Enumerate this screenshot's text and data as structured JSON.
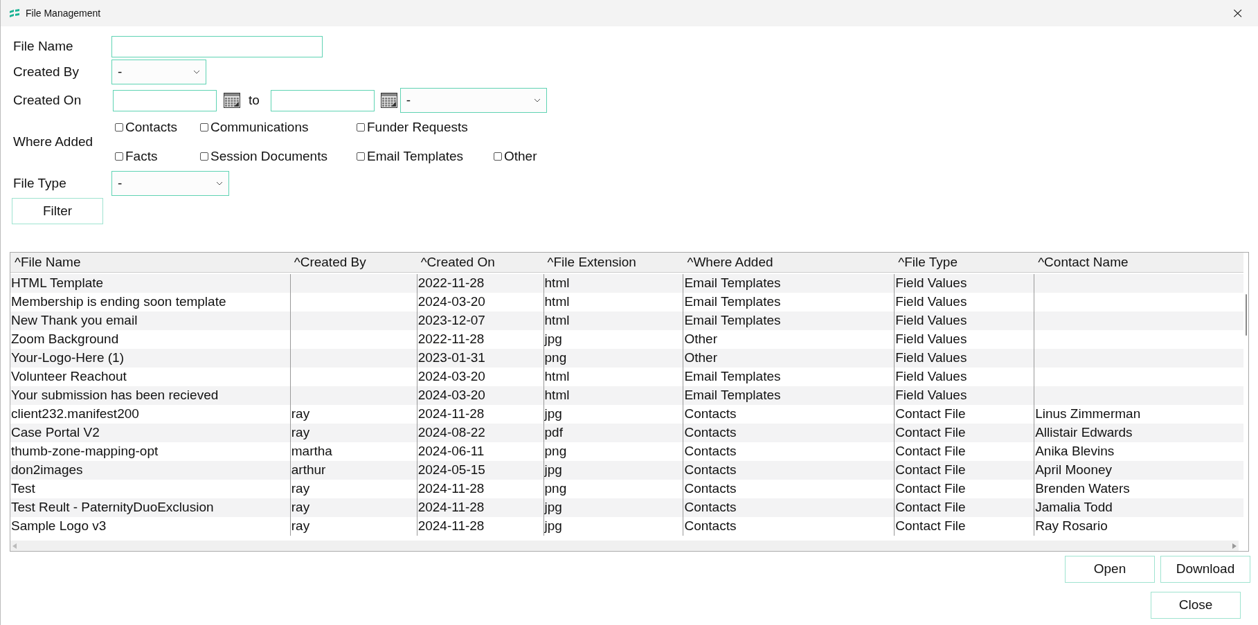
{
  "window": {
    "title": "File Management",
    "close": "×"
  },
  "filters": {
    "file_name": {
      "label": "File Name"
    },
    "created_by": {
      "label": "Created By",
      "value": "-"
    },
    "created_on": {
      "label": "Created On",
      "to_label": "to",
      "range": "-"
    },
    "where_added": {
      "label": "Where Added",
      "rows": [
        [
          {
            "label": "Contacts",
            "checked": false
          },
          {
            "label": "Communications",
            "checked": false
          },
          {
            "label": "Funder Requests",
            "checked": false
          }
        ],
        [
          {
            "label": "Facts",
            "checked": false
          },
          {
            "label": "Session Documents",
            "checked": false
          },
          {
            "label": "Email Templates",
            "checked": false
          },
          {
            "label": "Other",
            "checked": false
          }
        ]
      ]
    },
    "file_type": {
      "label": "File Type",
      "value": "-"
    },
    "filter_button": "Filter"
  },
  "table": {
    "columns": [
      "^File Name",
      "^Created By",
      "^Created On",
      "^File Extension",
      "^Where Added",
      "^File Type",
      "^Contact Name"
    ],
    "rows": [
      [
        "HTML Template",
        "",
        "2022-11-28",
        "html",
        "Email Templates",
        "Field Values",
        ""
      ],
      [
        "Membership is ending soon template",
        "",
        "2024-03-20",
        "html",
        "Email Templates",
        "Field Values",
        ""
      ],
      [
        "New Thank you email",
        "",
        "2023-12-07",
        "html",
        "Email Templates",
        "Field Values",
        ""
      ],
      [
        "Zoom Background",
        "",
        "2022-11-28",
        "jpg",
        "Other",
        "Field Values",
        ""
      ],
      [
        "Your-Logo-Here (1)",
        "",
        "2023-01-31",
        "png",
        "Other",
        "Field Values",
        ""
      ],
      [
        "Volunteer Reachout",
        "",
        "2024-03-20",
        "html",
        "Email Templates",
        "Field Values",
        ""
      ],
      [
        "Your submission has been recieved",
        "",
        "2024-03-20",
        "html",
        "Email Templates",
        "Field Values",
        ""
      ],
      [
        "client232.manifest200",
        "ray",
        "2024-11-28",
        "jpg",
        "Contacts",
        "Contact File",
        "Linus Zimmerman"
      ],
      [
        "Case Portal V2",
        "ray",
        "2024-08-22",
        "pdf",
        "Contacts",
        "Contact File",
        "Allistair Edwards"
      ],
      [
        "thumb-zone-mapping-opt",
        "martha",
        "2024-06-11",
        "png",
        "Contacts",
        "Contact File",
        "Anika Blevins"
      ],
      [
        "don2images",
        "arthur",
        "2024-05-15",
        "jpg",
        "Contacts",
        "Contact File",
        "April Mooney"
      ],
      [
        "Test",
        "ray",
        "2024-11-28",
        "png",
        "Contacts",
        "Contact File",
        "Brenden Waters"
      ],
      [
        "Test Reult - PaternityDuoExclusion",
        "ray",
        "2024-11-28",
        "jpg",
        "Contacts",
        "Contact File",
        "Jamalia Todd"
      ],
      [
        "Sample Logo v3",
        "ray",
        "2024-11-28",
        "jpg",
        "Contacts",
        "Contact File",
        "Ray Rosario"
      ]
    ]
  },
  "buttons": {
    "open": "Open",
    "download": "Download",
    "close": "Close"
  }
}
